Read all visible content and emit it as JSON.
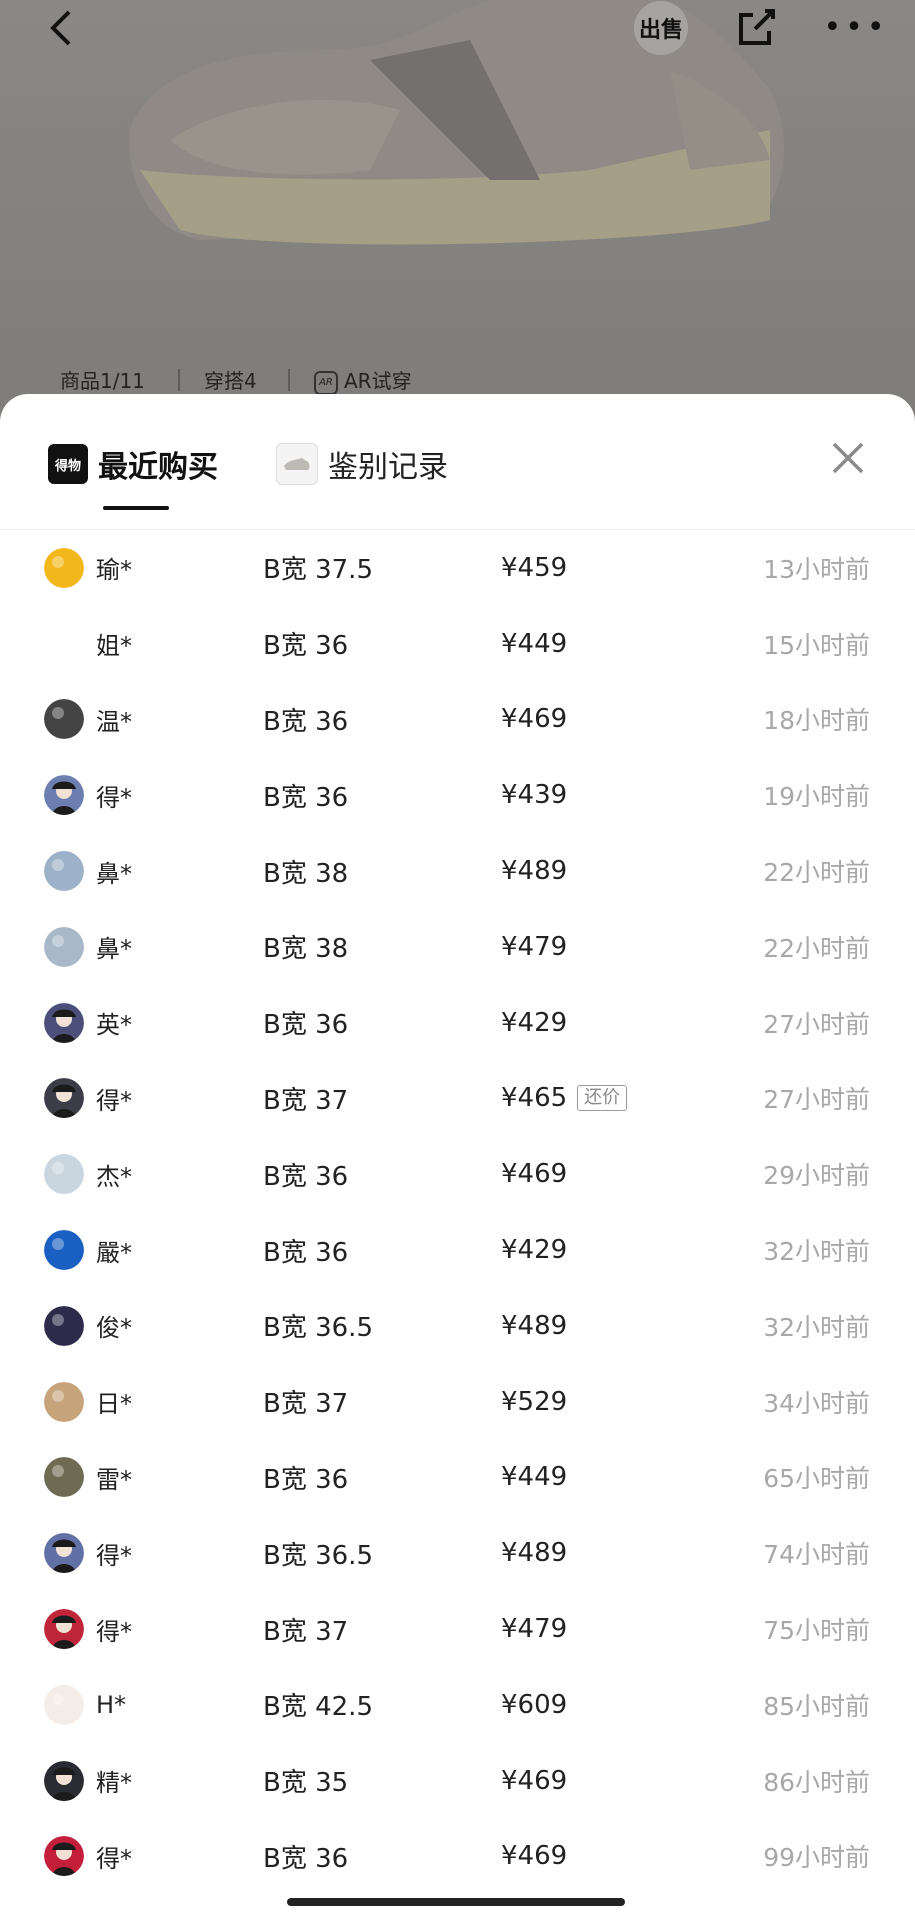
{
  "header": {
    "sell_label": "出售",
    "sub_tabs": [
      "商品1/11",
      "穿搭4",
      "AR试穿"
    ]
  },
  "sheet": {
    "tabs": [
      {
        "label": "最近购买",
        "icon": "dewu-logo-icon",
        "icon_text": "得物",
        "active": true
      },
      {
        "label": "鉴别记录",
        "icon": "shoe-thumbnail-icon",
        "active": false
      }
    ]
  },
  "colors": {
    "avatars": [
      "#f2b71a",
      "#ffffff",
      "#444444",
      "#6d7fb0",
      "#9db2c8",
      "#a9b8c9",
      "#4b4f7a",
      "#3d3d4a",
      "#c9d6e0",
      "#1a5fc2",
      "#2d2a4a",
      "#c7a37a",
      "#6f6a52",
      "#6270a8",
      "#c0263a",
      "#f4ece6",
      "#2b2b33",
      "#c41f3a"
    ]
  },
  "purchases": [
    {
      "user": "瑜*",
      "size": "B宽 37.5",
      "price": "¥459",
      "time": "13小时前",
      "avatar": "sunflower-avatar"
    },
    {
      "user": "姐*",
      "size": "B宽 36",
      "price": "¥449",
      "time": "15小时前",
      "avatar": "doodle-avatar"
    },
    {
      "user": "温*",
      "size": "B宽 36",
      "price": "¥469",
      "time": "18小时前",
      "avatar": "cartoon-avatar"
    },
    {
      "user": "得*",
      "size": "B宽 36",
      "price": "¥439",
      "time": "19小时前",
      "avatar": "default-avatar"
    },
    {
      "user": "鼻*",
      "size": "B宽 38",
      "price": "¥489",
      "time": "22小时前",
      "avatar": "sky-avatar"
    },
    {
      "user": "鼻*",
      "size": "B宽 38",
      "price": "¥479",
      "time": "22小时前",
      "avatar": "sky-avatar"
    },
    {
      "user": "英*",
      "size": "B宽 36",
      "price": "¥429",
      "time": "27小时前",
      "avatar": "default-avatar"
    },
    {
      "user": "得*",
      "size": "B宽 37",
      "price": "¥465",
      "time": "27小时前",
      "avatar": "default-avatar",
      "badge": "还价"
    },
    {
      "user": "杰*",
      "size": "B宽 36",
      "price": "¥469",
      "time": "29小时前",
      "avatar": "duck-avatar"
    },
    {
      "user": "嚴*",
      "size": "B宽 36",
      "price": "¥429",
      "time": "32小时前",
      "avatar": "ocean-avatar"
    },
    {
      "user": "俊*",
      "size": "B宽 36.5",
      "price": "¥489",
      "time": "32小时前",
      "avatar": "night-avatar"
    },
    {
      "user": "日*",
      "size": "B宽 37",
      "price": "¥529",
      "time": "34小时前",
      "avatar": "sunset-avatar"
    },
    {
      "user": "雷*",
      "size": "B宽 36",
      "price": "¥449",
      "time": "65小时前",
      "avatar": "photo-avatar"
    },
    {
      "user": "得*",
      "size": "B宽 36.5",
      "price": "¥489",
      "time": "74小时前",
      "avatar": "default-avatar"
    },
    {
      "user": "得*",
      "size": "B宽 37",
      "price": "¥479",
      "time": "75小时前",
      "avatar": "default-avatar"
    },
    {
      "user": "H*",
      "size": "B宽 42.5",
      "price": "¥609",
      "time": "85小时前",
      "avatar": "cat-avatar"
    },
    {
      "user": "精*",
      "size": "B宽 35",
      "price": "¥469",
      "time": "86小时前",
      "avatar": "default-avatar"
    },
    {
      "user": "得*",
      "size": "B宽 36",
      "price": "¥469",
      "time": "99小时前",
      "avatar": "default-avatar"
    }
  ]
}
